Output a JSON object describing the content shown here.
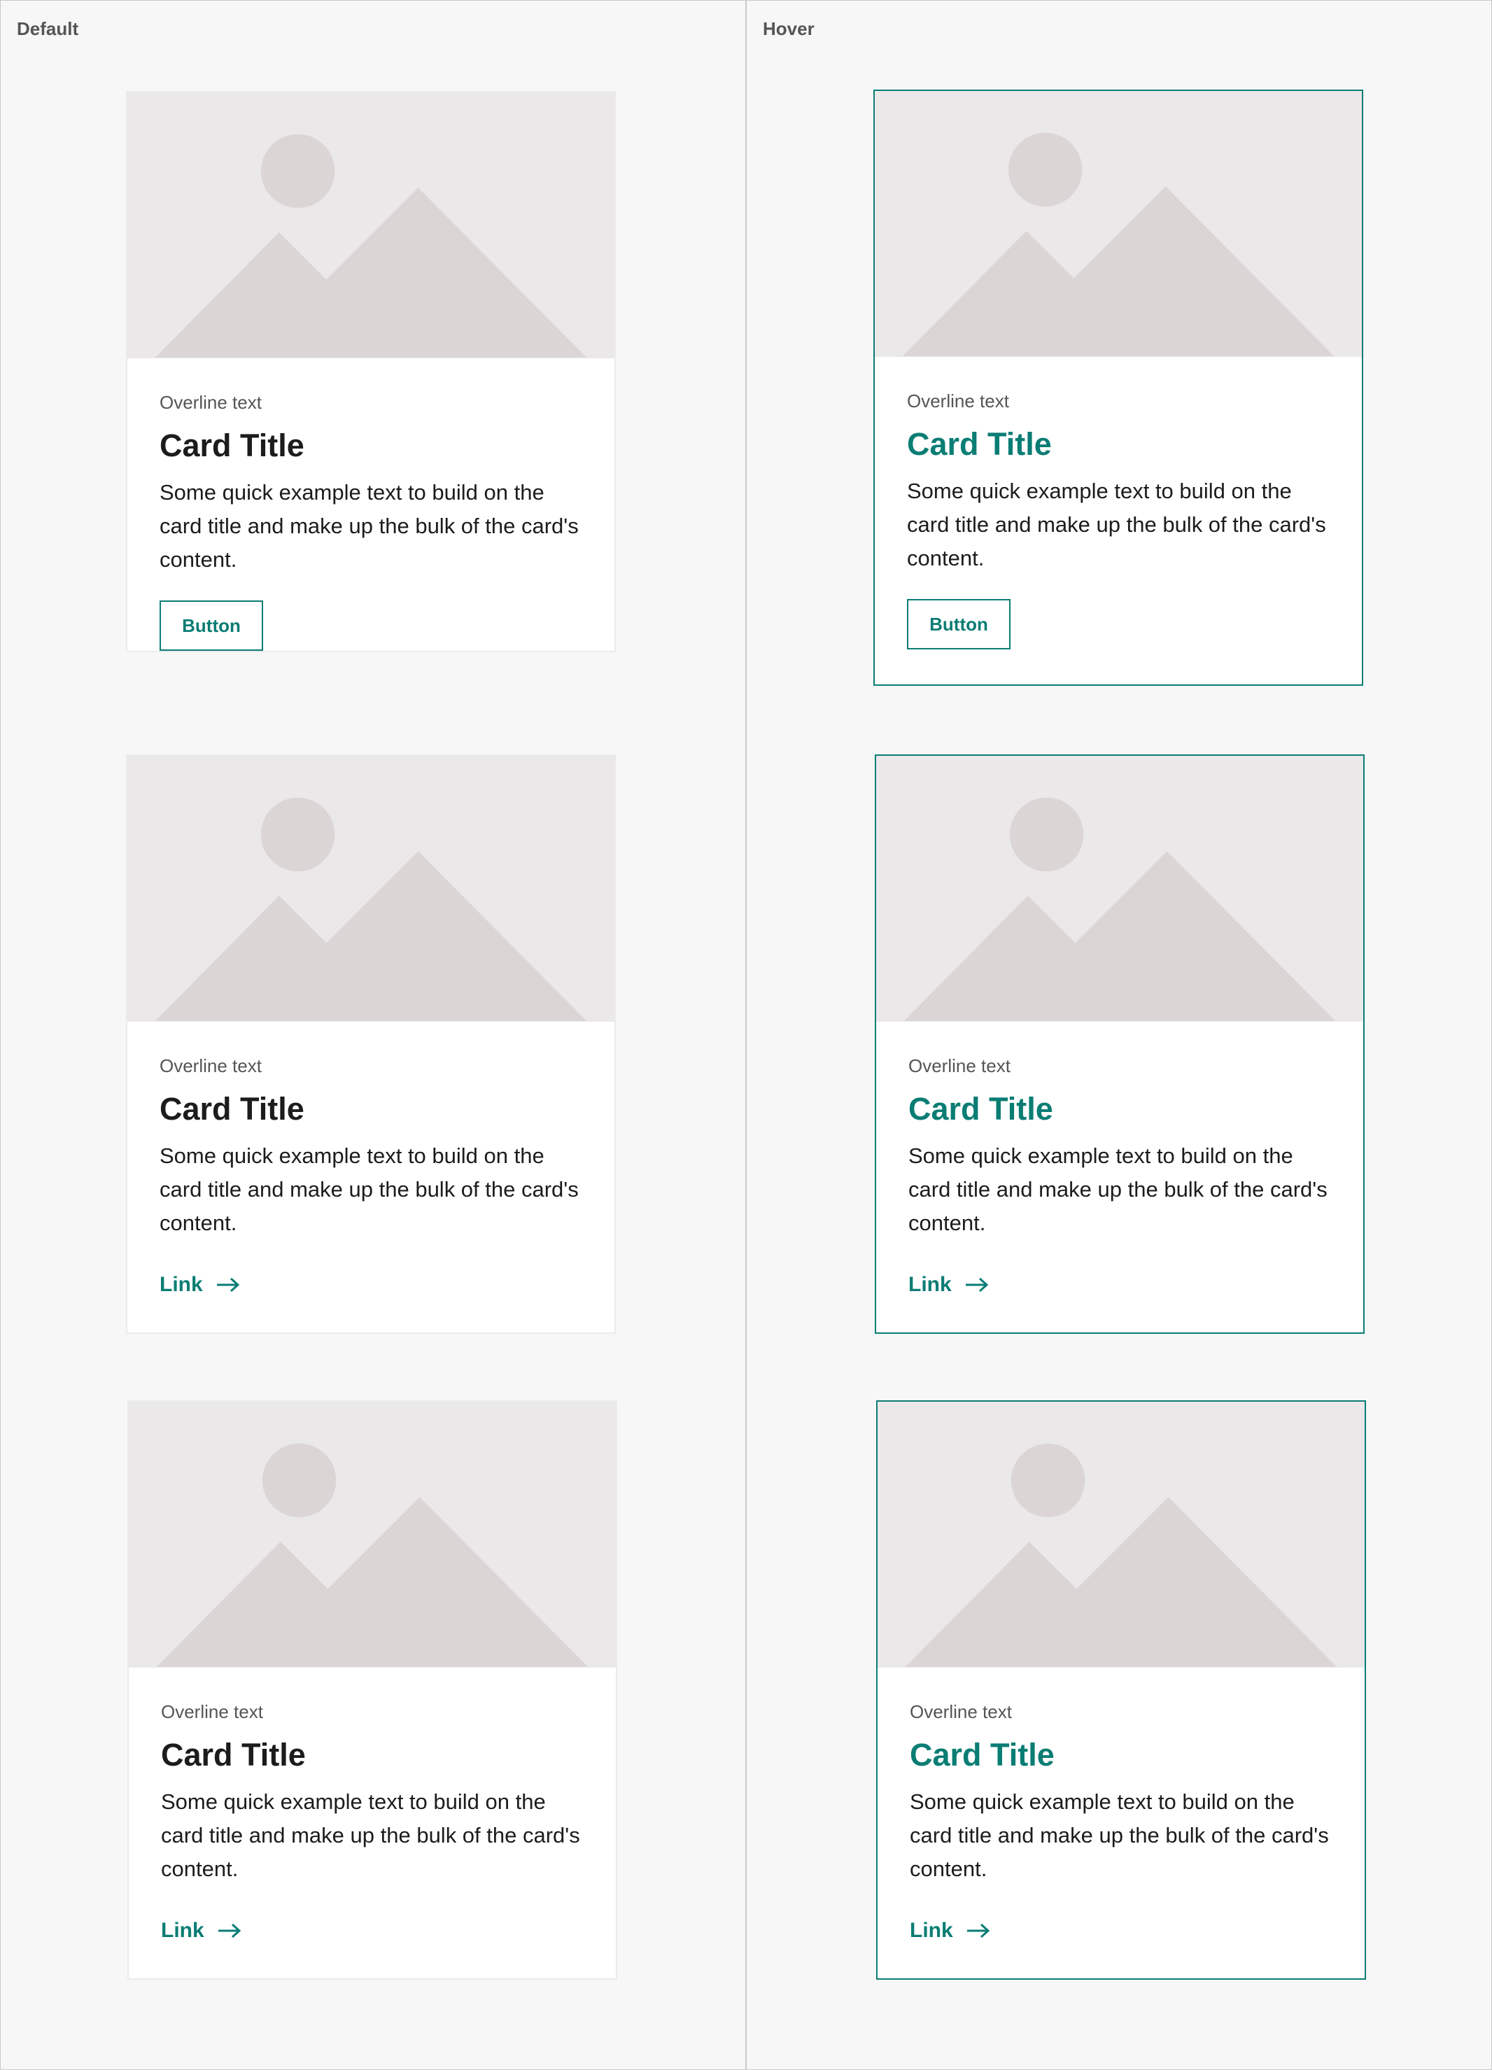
{
  "columns": {
    "default_label": "Default",
    "hover_label": "Hover"
  },
  "colors": {
    "accent": "#0a7d74",
    "image_bg": "#ebe8e9",
    "image_shape": "#dbd5d6",
    "text": "#1c1c1c",
    "muted": "#555555"
  },
  "cards": [
    {
      "overline": "Overline text",
      "title": "Card Title",
      "description": "Some quick example text to build on the card title and make up the bulk of the card's content.",
      "action": "Button"
    },
    {
      "overline": "Overline text",
      "title": "Card Title",
      "description": "Some quick example text to build on the card title and make up the bulk of the card's content.",
      "action": "Link"
    },
    {
      "overline": "Overline text",
      "title": "Card Title",
      "description": "Some quick example text to build on the card title and make up the bulk of the card's content.",
      "action": "Link"
    },
    {
      "overline": "Overline text",
      "title": "Card Title",
      "description": "Some quick example text to build on the card title and make up the bulk of the card's content.",
      "action": "Button"
    },
    {
      "overline": "Overline text",
      "title": "Card Title",
      "description": "Some quick example text to build on the card title and make up the bulk of the card's content.",
      "action": "Link"
    },
    {
      "overline": "Overline text",
      "title": "Card Title",
      "description": "Some quick example text to build on the card title and make up the bulk of the card's content.",
      "action": "Link"
    }
  ],
  "icons": {
    "image_placeholder": "image-placeholder-icon",
    "link_arrow": "arrow-right-icon"
  }
}
